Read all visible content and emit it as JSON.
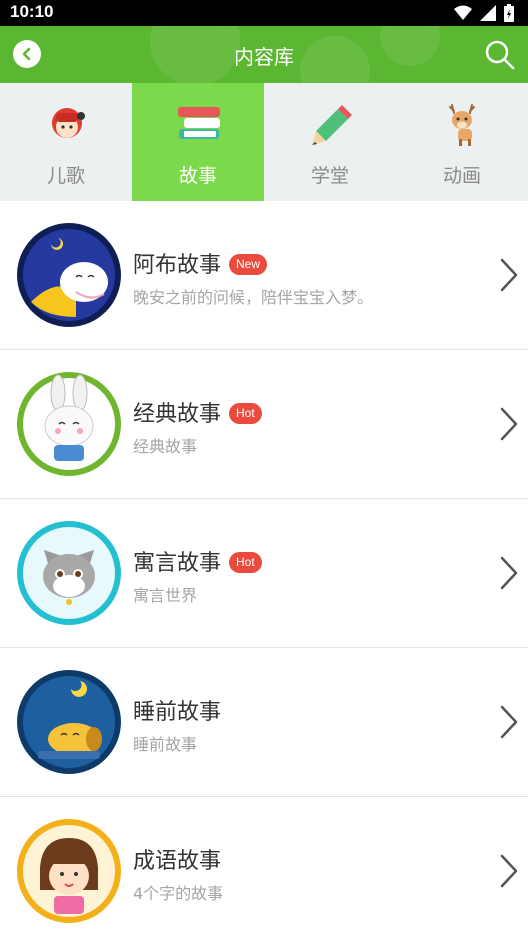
{
  "status": {
    "time": "10:10"
  },
  "header": {
    "title": "内容库"
  },
  "tabs": [
    {
      "label": "儿歌",
      "icon": "kids-song-icon"
    },
    {
      "label": "故事",
      "icon": "books-icon",
      "active": true
    },
    {
      "label": "学堂",
      "icon": "pencil-icon"
    },
    {
      "label": "动画",
      "icon": "deer-icon"
    }
  ],
  "items": [
    {
      "title": "阿布故事",
      "badge": "New",
      "subtitle": "晚安之前的问候，陪伴宝宝入梦。",
      "avatar_color": "#1f2f8e",
      "border_color": "#1f2f8e"
    },
    {
      "title": "经典故事",
      "badge": "Hot",
      "subtitle": "经典故事",
      "avatar_color": "#7cc53d",
      "border_color": "#7cc53d"
    },
    {
      "title": "寓言故事",
      "badge": "Hot",
      "subtitle": "寓言世界",
      "avatar_color": "#2ec6d6",
      "border_color": "#2ec6d6"
    },
    {
      "title": "睡前故事",
      "subtitle": "睡前故事",
      "avatar_color": "#1b4f86",
      "border_color": "#1b4f86"
    },
    {
      "title": "成语故事",
      "subtitle": "4个字的故事",
      "avatar_color": "#f6b81e",
      "border_color": "#f6b81e"
    }
  ],
  "colors": {
    "accent": "#5bb731",
    "active_tab": "#7dd94c",
    "badge": "#e94b3c"
  }
}
